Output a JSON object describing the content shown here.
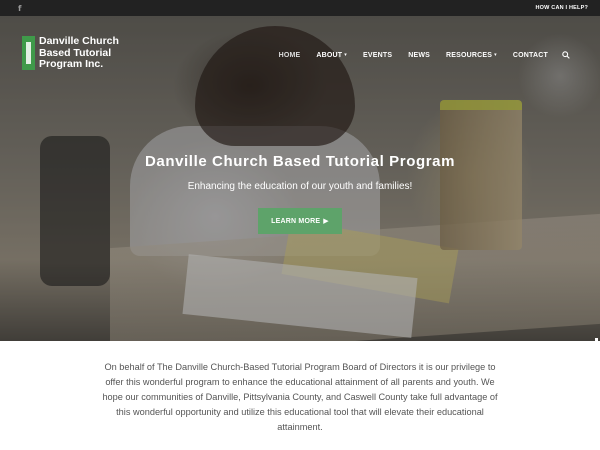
{
  "topbar": {
    "facebook_icon": "facebook-icon",
    "help_label": "HOW CAN I HELP?"
  },
  "brand": {
    "name": "Danville Church Based Tutorial Program Inc.",
    "accent_color": "#3f9a4a"
  },
  "nav": {
    "items": [
      {
        "label": "HOME",
        "active": true
      },
      {
        "label": "ABOUT",
        "dropdown": true
      },
      {
        "label": "EVENTS"
      },
      {
        "label": "NEWS"
      },
      {
        "label": "RESOURCES",
        "dropdown": true
      },
      {
        "label": "CONTACT"
      }
    ],
    "caret": "▾",
    "search_icon": "search-icon"
  },
  "hero": {
    "title": "Danville Church Based Tutorial Program",
    "subtitle": "Enhancing the education of our youth and families!",
    "cta_label": "LEARN MORE",
    "cta_icon": "▶",
    "cta_color": "#5ea36a"
  },
  "intro": {
    "text": "On behalf of The Danville Church-Based Tutorial Program Board of Directors it is our privilege to offer this wonderful program to enhance the educational attainment of all parents and youth. We hope our communities of Danville, Pittsylvania County, and Caswell County take full advantage of this wonderful opportunity and utilize this educational tool that will elevate their educational attainment."
  }
}
